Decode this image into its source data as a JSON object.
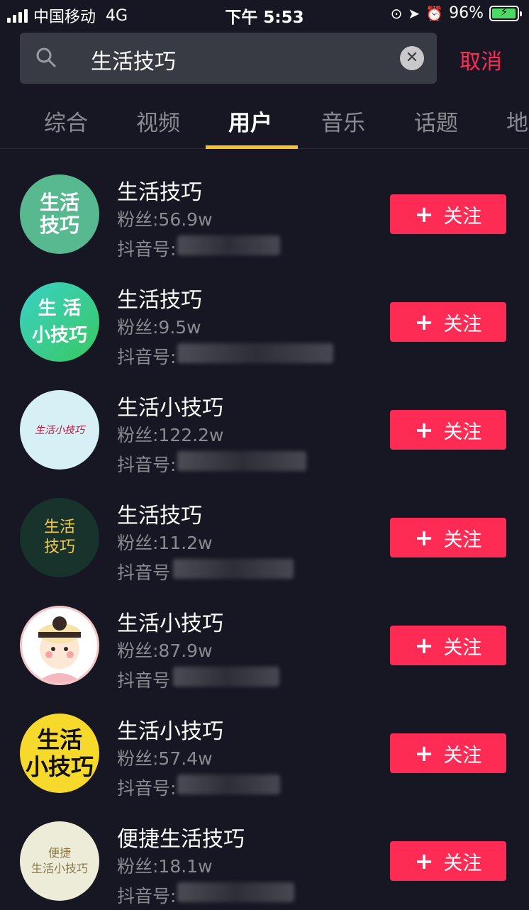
{
  "status_bar": {
    "carrier": "中国移动",
    "network": "4G",
    "time": "下午 5:53",
    "battery": "96%",
    "battery_level": 0.96
  },
  "search": {
    "query": "生活技巧",
    "cancel_label": "取消"
  },
  "tabs": [
    {
      "label": "综合"
    },
    {
      "label": "视频"
    },
    {
      "label": "用户"
    },
    {
      "label": "音乐"
    },
    {
      "label": "话题"
    },
    {
      "label": "地"
    }
  ],
  "active_tab": "用户",
  "follow_label": "关注",
  "users": [
    {
      "name": "生活技巧",
      "fans": "粉丝:56.9w",
      "id_prefix": "抖音号:",
      "avatar_text": "生活\n技巧"
    },
    {
      "name": "生活技巧",
      "fans": "粉丝:9.5w",
      "id_prefix": "抖音号:",
      "avatar_text": "生 活\n小技巧"
    },
    {
      "name": "生活小技巧",
      "fans": "粉丝:122.2w",
      "id_prefix": "抖音号:",
      "avatar_text": "生活小技巧"
    },
    {
      "name": "生活技巧",
      "fans": "粉丝:11.2w",
      "id_prefix": "抖音号",
      "avatar_text": "生活\n技巧"
    },
    {
      "name": "生活小技巧",
      "fans": "粉丝:87.9w",
      "id_prefix": "抖音号",
      "avatar_text": ""
    },
    {
      "name": "生活小技巧",
      "fans": "粉丝:57.4w",
      "id_prefix": "抖音号:",
      "avatar_text": "生活\n小技巧"
    },
    {
      "name": "便捷生活技巧",
      "fans": "粉丝:18.1w",
      "id_prefix": "抖音号:",
      "avatar_text": "便捷\n生活小技巧"
    }
  ],
  "colors": {
    "background": "#161722",
    "accent": "#fe2c55",
    "tab_indicator": "#f9c12b"
  }
}
